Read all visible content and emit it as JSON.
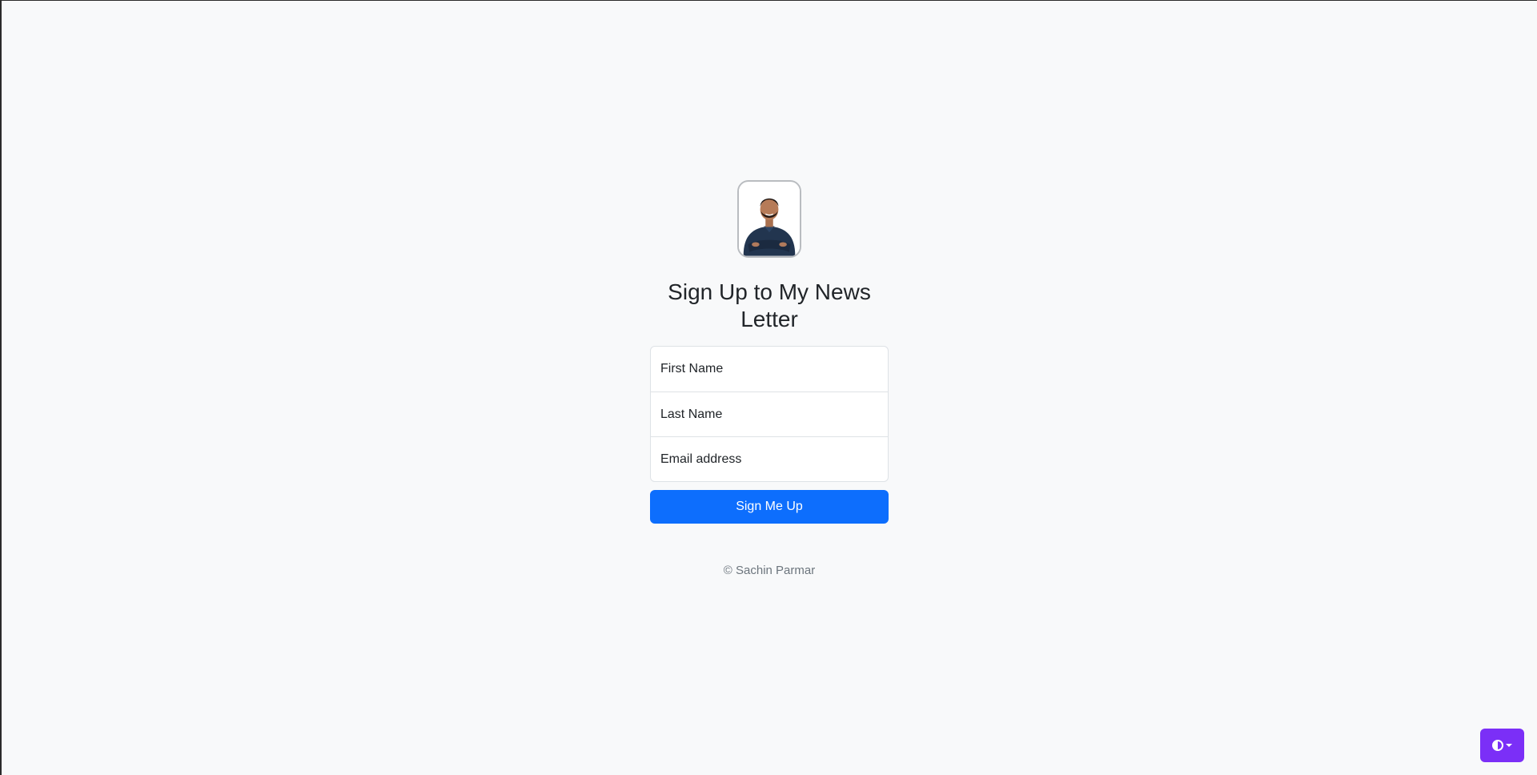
{
  "signup": {
    "avatar_icon": "profile-photo",
    "heading": "Sign Up to My News Letter",
    "fields": [
      {
        "placeholder": "First Name"
      },
      {
        "placeholder": "Last Name"
      },
      {
        "placeholder": "Email address"
      }
    ],
    "submit_label": "Sign Me Up",
    "footer": "© Sachin Parmar"
  },
  "theme_toggle": {
    "icon": "contrast-icon",
    "caret_icon": "caret-down-icon"
  },
  "colors": {
    "background": "#f8f9fa",
    "primary": "#0d6efd",
    "toggle": "#7b2ff7",
    "muted": "#6c757d"
  }
}
